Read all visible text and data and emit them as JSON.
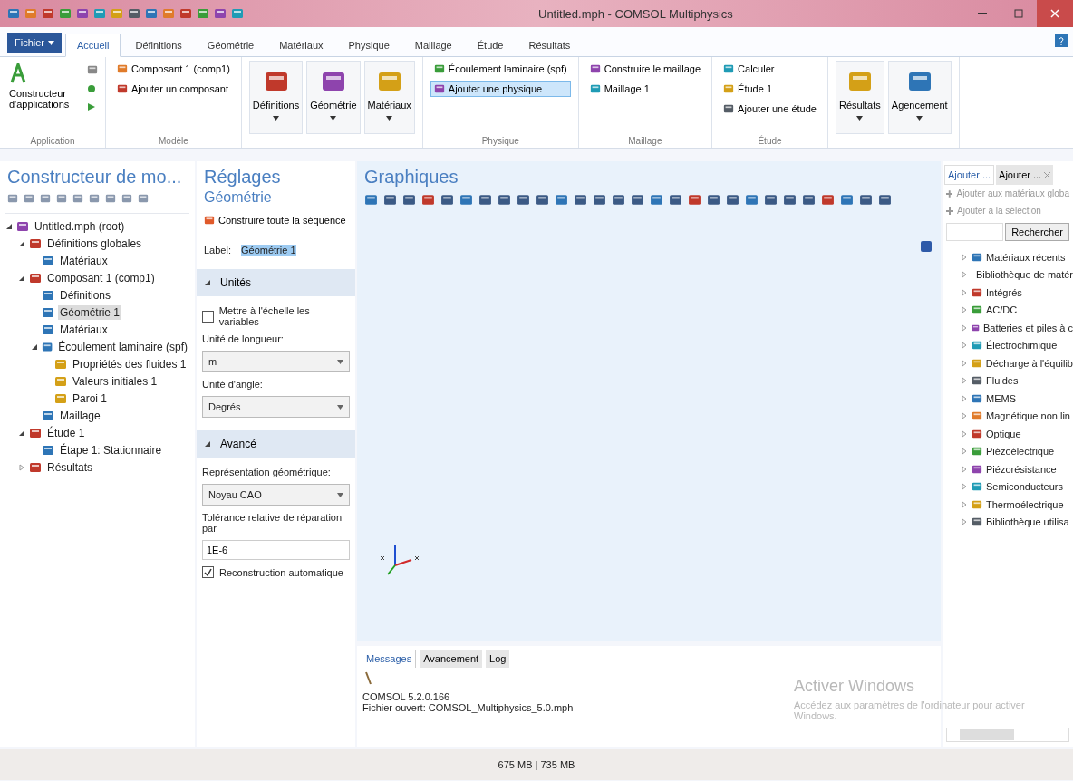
{
  "window": {
    "title": "Untitled.mph - COMSOL Multiphysics"
  },
  "ribbon_tabs": [
    {
      "label": "Fichier",
      "kind": "file",
      "selected": false
    },
    {
      "label": "Accueil",
      "kind": "tab",
      "selected": true
    },
    {
      "label": "Définitions",
      "kind": "tab",
      "selected": false
    },
    {
      "label": "Géométrie",
      "kind": "tab",
      "selected": false
    },
    {
      "label": "Matériaux",
      "kind": "tab",
      "selected": false
    },
    {
      "label": "Physique",
      "kind": "tab",
      "selected": false
    },
    {
      "label": "Maillage",
      "kind": "tab",
      "selected": false
    },
    {
      "label": "Étude",
      "kind": "tab",
      "selected": false
    },
    {
      "label": "Résultats",
      "kind": "tab",
      "selected": false
    }
  ],
  "ribbon_groups": [
    {
      "name": "Application",
      "kind": "app",
      "items": [
        {
          "label": "Constructeur d'applications",
          "selected": false
        }
      ]
    },
    {
      "name": "Modèle",
      "kind": "list",
      "items": [
        {
          "label": "Composant 1 (comp1)",
          "selected": false
        },
        {
          "label": "Ajouter un composant",
          "selected": false
        }
      ]
    },
    {
      "kind": "big",
      "items": [
        {
          "label": "Définitions",
          "selected": false
        },
        {
          "label": "Géométrie",
          "selected": false
        },
        {
          "label": "Matériaux",
          "selected": false
        }
      ]
    },
    {
      "name": "Physique",
      "kind": "list",
      "items": [
        {
          "label": "Écoulement laminaire (spf)",
          "selected": false
        },
        {
          "label": "Ajouter une physique",
          "selected": true
        }
      ]
    },
    {
      "name": "Maillage",
      "kind": "list",
      "items": [
        {
          "label": "Construire le maillage",
          "selected": false
        },
        {
          "label": "Maillage 1",
          "selected": false
        }
      ]
    },
    {
      "name": "Étude",
      "kind": "list",
      "items": [
        {
          "label": "Calculer",
          "selected": false
        },
        {
          "label": "Étude 1",
          "selected": false
        },
        {
          "label": "Ajouter une étude",
          "selected": false
        }
      ]
    },
    {
      "kind": "big",
      "items": [
        {
          "label": "Résultats",
          "selected": false
        },
        {
          "label": "Agencement",
          "selected": false
        }
      ]
    }
  ],
  "model_builder": {
    "title": "Constructeur de mo...",
    "tree": [
      {
        "label": "Untitled.mph (root)",
        "expanded": true,
        "selected": false,
        "children": [
          {
            "label": "Définitions globales",
            "expanded": true,
            "selected": false,
            "children": [
              {
                "label": "Matériaux",
                "selected": false
              }
            ]
          },
          {
            "label": "Composant 1 (comp1)",
            "expanded": true,
            "selected": false,
            "children": [
              {
                "label": "Définitions",
                "selected": false
              },
              {
                "label": "Géométrie 1",
                "selected": true
              },
              {
                "label": "Matériaux",
                "selected": false
              },
              {
                "label": "Écoulement laminaire (spf)",
                "expanded": true,
                "selected": false,
                "children": [
                  {
                    "label": "Propriétés des fluides 1",
                    "selected": false
                  },
                  {
                    "label": "Valeurs initiales 1",
                    "selected": false
                  },
                  {
                    "label": "Paroi 1",
                    "selected": false
                  }
                ]
              },
              {
                "label": "Maillage",
                "selected": false
              }
            ]
          },
          {
            "label": "Étude 1",
            "expanded": true,
            "selected": false,
            "children": [
              {
                "label": "Étape 1: Stationnaire",
                "selected": false
              }
            ]
          },
          {
            "label": "Résultats",
            "expanded": false,
            "selected": false
          }
        ]
      }
    ]
  },
  "settings": {
    "title": "Réglages",
    "subtitle": "Géométrie",
    "build_button": "Construire toute la séquence",
    "label_caption": "Label:",
    "label_value": "Géométrie 1",
    "sections": [
      {
        "title": "Unités",
        "expanded": true,
        "fields": [
          {
            "kind": "checkbox",
            "label": "Mettre à l'échelle les variables",
            "checked": false
          },
          {
            "kind": "select",
            "label": "Unité de longueur:",
            "value": "m"
          },
          {
            "kind": "select",
            "label": "Unité d'angle:",
            "value": "Degrés"
          }
        ]
      },
      {
        "title": "Avancé",
        "expanded": true,
        "fields": [
          {
            "kind": "select",
            "label": "Représentation géométrique:",
            "value": "Noyau CAO"
          },
          {
            "kind": "text",
            "label": "Tolérance relative de réparation par",
            "value": "1E-6"
          },
          {
            "kind": "checkbox",
            "label": "Reconstruction automatique",
            "checked": true
          }
        ]
      }
    ]
  },
  "graphics": {
    "title": "Graphiques"
  },
  "messages": {
    "tabs": [
      {
        "label": "Messages",
        "selected": true
      },
      {
        "label": "Avancement",
        "selected": false
      },
      {
        "label": "Log",
        "selected": false
      }
    ],
    "lines": [
      "COMSOL 5.2.0.166",
      "Fichier ouvert: COMSOL_Multiphysics_5.0.mph"
    ],
    "overlay_title": "Activer Windows",
    "overlay_text": "Accédez aux paramètres de l'ordinateur pour activer Windows."
  },
  "add_panel": {
    "tabs": [
      {
        "label": "Ajouter ...",
        "selected": true,
        "closable": false
      },
      {
        "label": "Ajouter ...",
        "selected": false,
        "closable": true
      }
    ],
    "actions": [
      "Ajouter aux matériaux globa",
      "Ajouter à la sélection"
    ],
    "search_button": "Rechercher",
    "items": [
      "Matériaux récents",
      "Bibliothèque de matér",
      "Intégrés",
      "AC/DC",
      "Batteries et piles à c",
      "Électrochimique",
      "Décharge à l'équilib",
      "Fluides",
      "MEMS",
      "Magnétique non lin",
      "Optique",
      "Piézoélectrique",
      "Piézorésistance",
      "Semiconducteurs",
      "Thermoélectrique",
      "Bibliothèque utilisa"
    ]
  },
  "status_bar": {
    "memory": "675 MB | 735 MB"
  }
}
